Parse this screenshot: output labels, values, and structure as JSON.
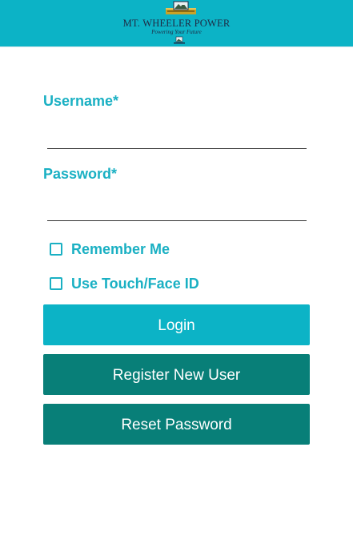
{
  "header": {
    "brand_name": "MT. WHEELER POWER",
    "tagline": "Powering Your Future",
    "colors": {
      "background": "#0cb3c6"
    }
  },
  "form": {
    "username": {
      "label": "Username*",
      "value": "",
      "placeholder": ""
    },
    "password": {
      "label": "Password*",
      "value": "",
      "placeholder": ""
    },
    "remember_me": {
      "label": "Remember Me",
      "checked": false
    },
    "touch_face_id": {
      "label": "Use Touch/Face ID",
      "checked": false
    }
  },
  "buttons": {
    "login": "Login",
    "register": "Register New User",
    "reset": "Reset Password"
  },
  "colors": {
    "accent": "#0cb3c6",
    "secondary": "#087f78",
    "label_text": "#1ab0c3"
  }
}
